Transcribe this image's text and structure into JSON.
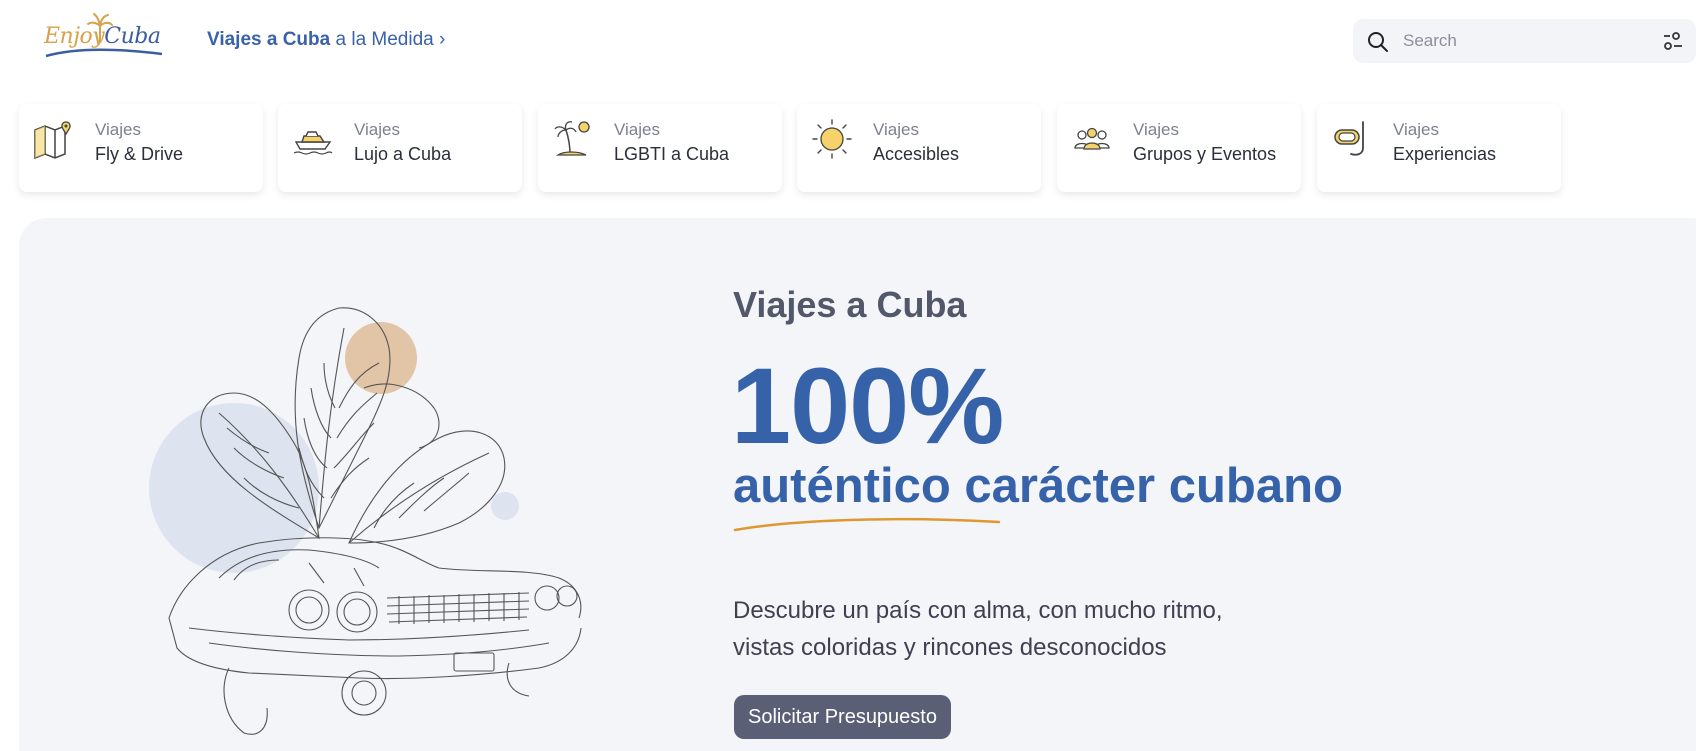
{
  "header": {
    "logo_enjoy": "Enjoy",
    "logo_cuba": "Cuba",
    "tagline_bold": "Viajes a Cuba",
    "tagline_rest": "a la Medida ›",
    "search_placeholder": "Search"
  },
  "categories": [
    {
      "top": "Viajes",
      "bottom": "Fly & Drive",
      "icon": "map-icon"
    },
    {
      "top": "Viajes",
      "bottom": "Lujo a Cuba",
      "icon": "yacht-icon"
    },
    {
      "top": "Viajes",
      "bottom": "LGBTI a Cuba",
      "icon": "palm-island-icon"
    },
    {
      "top": "Viajes",
      "bottom": "Accesibles",
      "icon": "sun-icon"
    },
    {
      "top": "Viajes",
      "bottom": "Grupos y Eventos",
      "icon": "group-icon"
    },
    {
      "top": "Viajes",
      "bottom": "Experiencias",
      "icon": "snorkel-icon"
    }
  ],
  "hero": {
    "eyebrow": "Viajes a Cuba",
    "big": "100%",
    "sub": "auténtico carácter cubano",
    "desc_line1": "Descubre un país con alma, con mucho ritmo,",
    "desc_line2": "vistas coloridas y rincones desconocidos",
    "cta": "Solicitar Presupuesto",
    "illustration": "classic-car-with-monstera-leaves"
  },
  "colors": {
    "brand_blue": "#3562a8",
    "accent_orange": "#e0972f",
    "icon_yellow": "#f5d36a",
    "cta_bg": "#5b5f75",
    "hero_bg": "#f4f5f9"
  }
}
